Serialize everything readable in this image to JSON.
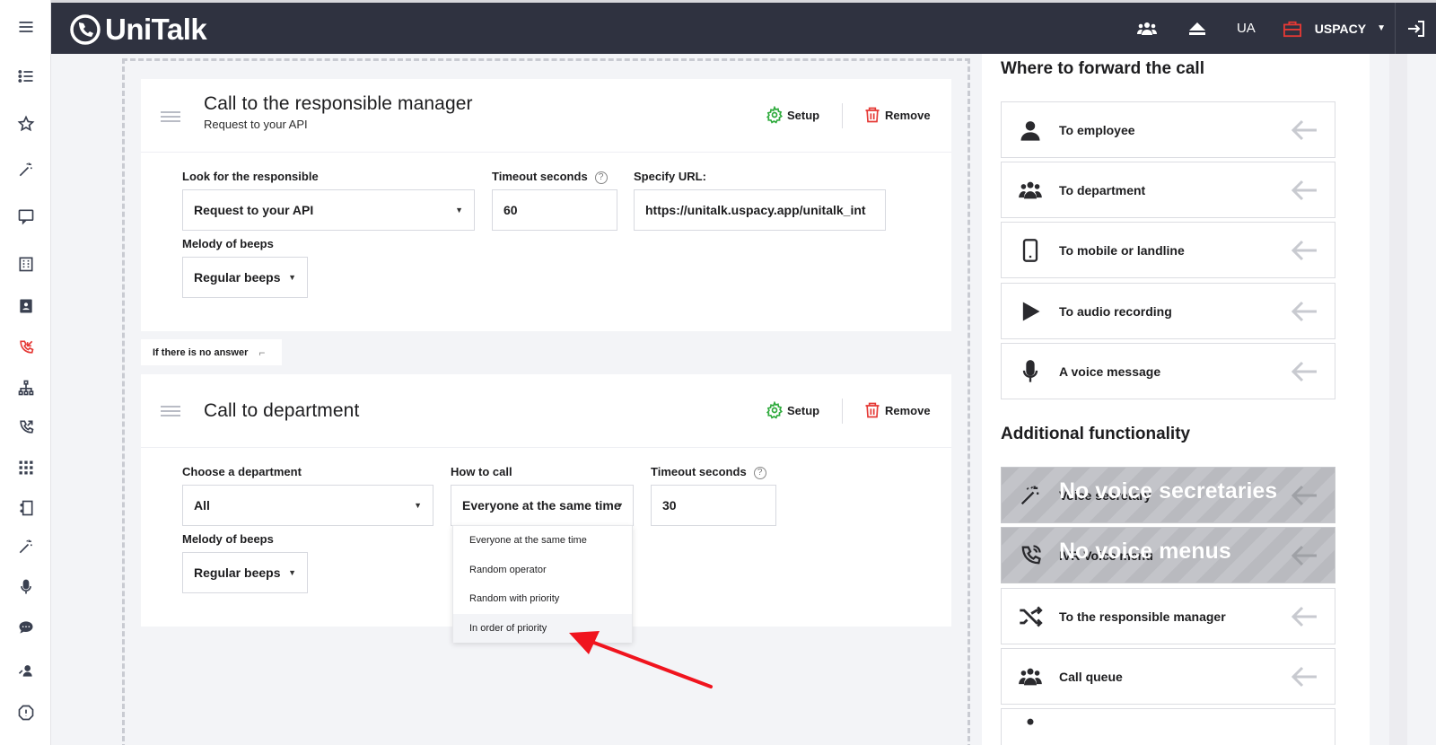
{
  "app": {
    "logo_text": "UniTalk"
  },
  "topbar": {
    "language": "UA",
    "company": "USPACY"
  },
  "sidebar": {
    "items": [
      "menu-icon",
      "list-icon",
      "star-icon",
      "magic-wand-icon",
      "chat-bubble-icon",
      "building-icon",
      "contacts-icon",
      "missed-call-icon",
      "org-chart-icon",
      "outgoing-call-icon",
      "apps-grid-icon",
      "phone-book-icon",
      "magic-wand-icon",
      "microphone-icon",
      "chat-icon",
      "support-agent-icon",
      "alert-icon"
    ]
  },
  "card1": {
    "title": "Call to the responsible manager",
    "subtitle": "Request to your API",
    "setup_label": "Setup",
    "remove_label": "Remove",
    "look_label": "Look for the responsible",
    "look_value": "Request to your API",
    "timeout_label": "Timeout seconds",
    "timeout_value": "60",
    "url_label": "Specify URL:",
    "url_value": "https://unitalk.uspacy.app/unitalk_int",
    "melody_label": "Melody of beeps",
    "melody_value": "Regular beeps"
  },
  "no_answer_label": "If there is no answer",
  "card2": {
    "title": "Call to department",
    "setup_label": "Setup",
    "remove_label": "Remove",
    "department_label": "Choose a department",
    "department_value": "All",
    "how_label": "How to call",
    "how_value": "Everyone at the same time",
    "timeout_label": "Timeout seconds",
    "timeout_value": "30",
    "melody_label": "Melody of beeps",
    "melody_value": "Regular beeps",
    "how_options": [
      "Everyone at the same time",
      "Random operator",
      "Random with priority",
      "In order of priority"
    ]
  },
  "help_glyph": "?",
  "right_panel": {
    "forward_title": "Where to forward the call",
    "forward_items": [
      {
        "label": "To employee",
        "icon": "person-icon"
      },
      {
        "label": "To department",
        "icon": "group-icon"
      },
      {
        "label": "To mobile or landline",
        "icon": "mobile-phone-icon"
      },
      {
        "label": "To audio recording",
        "icon": "play-icon"
      },
      {
        "label": "A voice message",
        "icon": "microphone-icon"
      }
    ],
    "additional_title": "Additional functionality",
    "additional_items": [
      {
        "label": "Voice secretary",
        "overlay": "No voice secretaries",
        "icon": "magic-wand-icon",
        "disabled": true
      },
      {
        "label": "IVR Voice menu",
        "overlay": "No voice menus",
        "icon": "phone-ring-icon",
        "disabled": true
      },
      {
        "label": "To the responsible manager",
        "icon": "shuffle-icon"
      },
      {
        "label": "Call queue",
        "icon": "group-icon"
      }
    ]
  },
  "colors": {
    "topbar": "#2f3240",
    "accent_red": "#e53935",
    "setup_green": "#2eaa3c",
    "arrow_red": "#f0141e"
  }
}
